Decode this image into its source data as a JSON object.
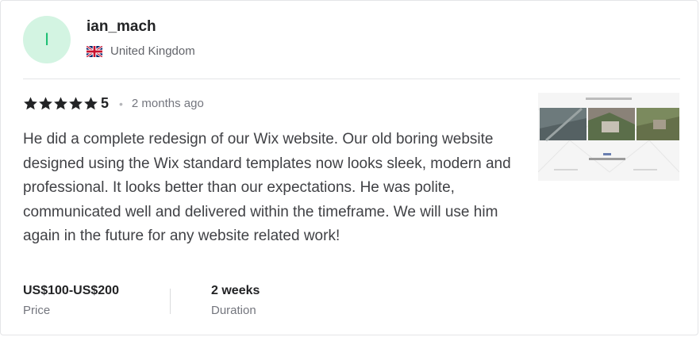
{
  "reviewer": {
    "avatar_initial": "I",
    "username": "ian_mach",
    "country": "United Kingdom",
    "flag_icon": "uk-flag-icon"
  },
  "rating": {
    "value": "5",
    "stars_filled": 5,
    "stars_total": 5,
    "separator": "•",
    "time_ago": "2 months ago"
  },
  "review": {
    "text": "He did a complete redesign of our Wix website. Our old boring website designed using the Wix standard templates now looks sleek, modern and professional. It looks better than our expectations. He was polite, communicated well and delivered within the timeframe. We will use him again in the future for any website related work!"
  },
  "meta": {
    "price_value": "US$100-US$200",
    "price_label": "Price",
    "duration_value": "2 weeks",
    "duration_label": "Duration"
  },
  "colors": {
    "avatar_bg": "#d3f4e2",
    "avatar_text": "#1dbf73",
    "star": "#222325"
  }
}
